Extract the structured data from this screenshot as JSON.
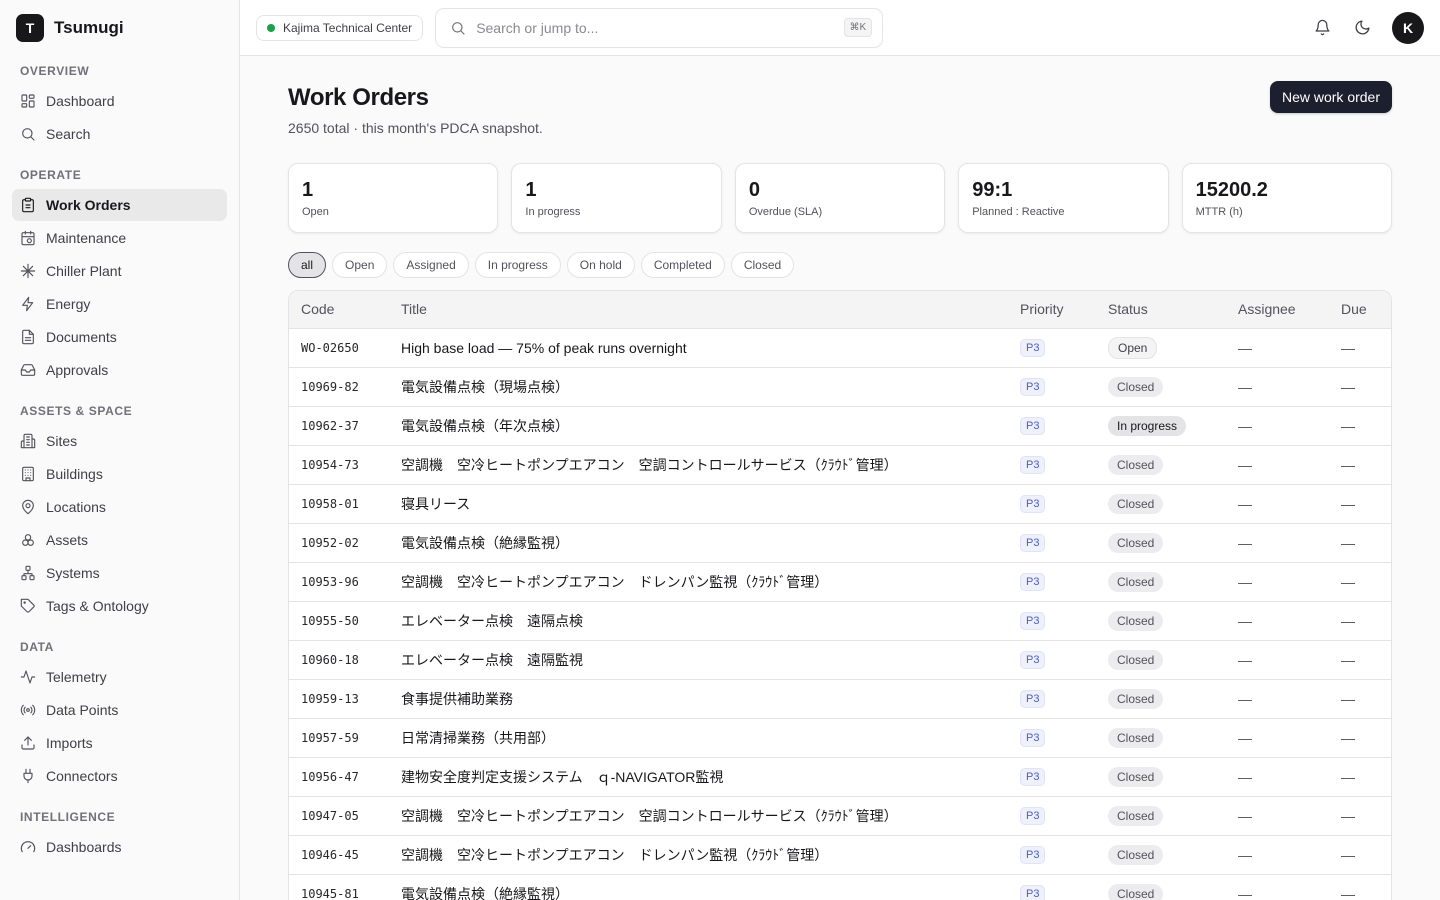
{
  "app": {
    "logo_letter": "T",
    "name": "Tsumugi"
  },
  "sidebar": {
    "sections": [
      {
        "heading": "OVERVIEW",
        "items": [
          {
            "label": "Dashboard",
            "icon": "grid-icon"
          },
          {
            "label": "Search",
            "icon": "search-icon"
          }
        ]
      },
      {
        "heading": "OPERATE",
        "items": [
          {
            "label": "Work Orders",
            "icon": "clipboard-icon",
            "active": true
          },
          {
            "label": "Maintenance",
            "icon": "calendar-icon"
          },
          {
            "label": "Chiller Plant",
            "icon": "snowflake-icon"
          },
          {
            "label": "Energy",
            "icon": "bolt-icon"
          },
          {
            "label": "Documents",
            "icon": "document-icon"
          },
          {
            "label": "Approvals",
            "icon": "inbox-icon"
          }
        ]
      },
      {
        "heading": "ASSETS & SPACE",
        "items": [
          {
            "label": "Sites",
            "icon": "building-icon"
          },
          {
            "label": "Buildings",
            "icon": "office-icon"
          },
          {
            "label": "Locations",
            "icon": "map-pin-icon"
          },
          {
            "label": "Assets",
            "icon": "boxes-icon"
          },
          {
            "label": "Systems",
            "icon": "network-icon"
          },
          {
            "label": "Tags & Ontology",
            "icon": "tag-icon"
          }
        ]
      },
      {
        "heading": "DATA",
        "items": [
          {
            "label": "Telemetry",
            "icon": "activity-icon"
          },
          {
            "label": "Data Points",
            "icon": "radio-icon"
          },
          {
            "label": "Imports",
            "icon": "upload-icon"
          },
          {
            "label": "Connectors",
            "icon": "plug-icon"
          }
        ]
      },
      {
        "heading": "INTELLIGENCE",
        "items": [
          {
            "label": "Dashboards",
            "icon": "gauge-icon"
          }
        ]
      }
    ]
  },
  "topbar": {
    "site_name": "Kajima Technical Center",
    "search_placeholder": "Search or jump to...",
    "shortcut": "⌘K",
    "avatar_letter": "K"
  },
  "page": {
    "title": "Work Orders",
    "subtitle": "2650 total · this month's PDCA snapshot.",
    "new_button": "New work order"
  },
  "kpis": [
    {
      "value": "1",
      "label": "Open"
    },
    {
      "value": "1",
      "label": "In progress"
    },
    {
      "value": "0",
      "label": "Overdue (SLA)"
    },
    {
      "value": "99:1",
      "label": "Planned : Reactive"
    },
    {
      "value": "15200.2",
      "label": "MTTR (h)"
    }
  ],
  "filters": [
    {
      "label": "all",
      "active": true
    },
    {
      "label": "Open"
    },
    {
      "label": "Assigned"
    },
    {
      "label": "In progress"
    },
    {
      "label": "On hold"
    },
    {
      "label": "Completed"
    },
    {
      "label": "Closed"
    }
  ],
  "table": {
    "columns": [
      "Code",
      "Title",
      "Priority",
      "Status",
      "Assignee",
      "Due"
    ],
    "rows": [
      {
        "code": "WO-02650",
        "title": "High base load — 75% of peak runs overnight",
        "priority": "P3",
        "status": "Open",
        "assignee": "—",
        "due": "—"
      },
      {
        "code": "10969-82",
        "title": "電気設備点検（現場点検）",
        "priority": "P3",
        "status": "Closed",
        "assignee": "—",
        "due": "—"
      },
      {
        "code": "10962-37",
        "title": "電気設備点検（年次点検）",
        "priority": "P3",
        "status": "In progress",
        "assignee": "—",
        "due": "—"
      },
      {
        "code": "10954-73",
        "title": "空調機　空冷ヒートポンプエアコン　空調コントロールサービス（ｸﾗｳﾄﾞ管理）",
        "priority": "P3",
        "status": "Closed",
        "assignee": "—",
        "due": "—"
      },
      {
        "code": "10958-01",
        "title": "寝具リース",
        "priority": "P3",
        "status": "Closed",
        "assignee": "—",
        "due": "—"
      },
      {
        "code": "10952-02",
        "title": "電気設備点検（絶縁監視）",
        "priority": "P3",
        "status": "Closed",
        "assignee": "—",
        "due": "—"
      },
      {
        "code": "10953-96",
        "title": "空調機　空冷ヒートポンプエアコン　ドレンパン監視（ｸﾗｳﾄﾞ管理）",
        "priority": "P3",
        "status": "Closed",
        "assignee": "—",
        "due": "—"
      },
      {
        "code": "10955-50",
        "title": "エレベーター点検　遠隔点検",
        "priority": "P3",
        "status": "Closed",
        "assignee": "—",
        "due": "—"
      },
      {
        "code": "10960-18",
        "title": "エレベーター点検　遠隔監視",
        "priority": "P3",
        "status": "Closed",
        "assignee": "—",
        "due": "—"
      },
      {
        "code": "10959-13",
        "title": "食事提供補助業務",
        "priority": "P3",
        "status": "Closed",
        "assignee": "—",
        "due": "—"
      },
      {
        "code": "10957-59",
        "title": "日常清掃業務（共用部）",
        "priority": "P3",
        "status": "Closed",
        "assignee": "—",
        "due": "—"
      },
      {
        "code": "10956-47",
        "title": "建物安全度判定支援システム　ｑ-NAVIGATOR監視",
        "priority": "P3",
        "status": "Closed",
        "assignee": "—",
        "due": "—"
      },
      {
        "code": "10947-05",
        "title": "空調機　空冷ヒートポンプエアコン　空調コントロールサービス（ｸﾗｳﾄﾞ管理）",
        "priority": "P3",
        "status": "Closed",
        "assignee": "—",
        "due": "—"
      },
      {
        "code": "10946-45",
        "title": "空調機　空冷ヒートポンプエアコン　ドレンパン監視（ｸﾗｳﾄﾞ管理）",
        "priority": "P3",
        "status": "Closed",
        "assignee": "—",
        "due": "—"
      },
      {
        "code": "10945-81",
        "title": "電気設備点検（絶縁監視）",
        "priority": "P3",
        "status": "Closed",
        "assignee": "—",
        "due": "—"
      }
    ]
  }
}
